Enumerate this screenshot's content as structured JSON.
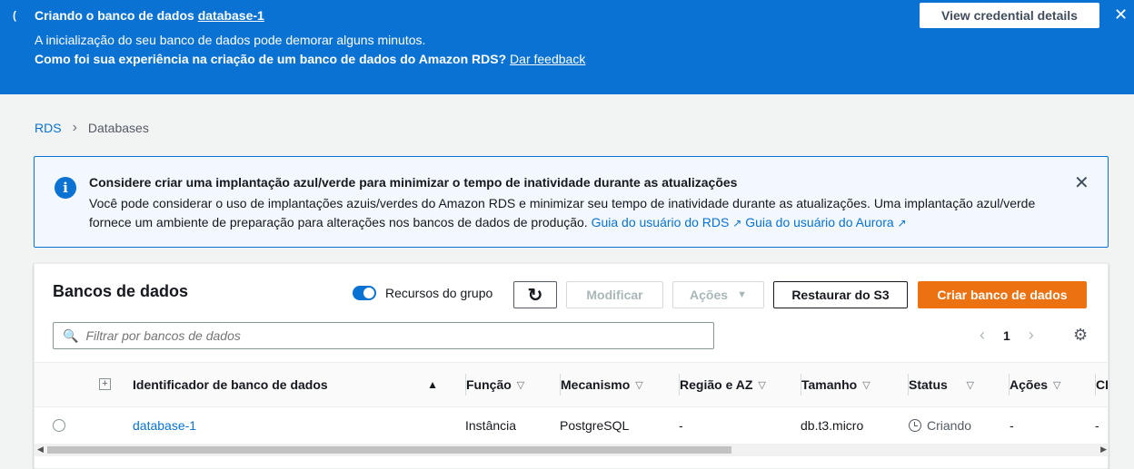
{
  "flash": {
    "title_prefix": "Criando o banco de dados",
    "title_link": "database-1",
    "message": "A inicialização do seu banco de dados pode demorar alguns minutos.",
    "feedback_question": "Como foi sua experiência na criação de um banco de dados do Amazon RDS?",
    "feedback_link": "Dar feedback",
    "credentials_button": "View credential details",
    "close_icon": "close-icon"
  },
  "breadcrumb": {
    "items": [
      "RDS",
      "Databases"
    ]
  },
  "alert": {
    "title": "Considere criar uma implantação azul/verde para minimizar o tempo de inatividade durante as atualizações",
    "body": "Você pode considerar o uso de implantações azuis/verdes do Amazon RDS e minimizar seu tempo de inatividade durante as atualizações. Uma implantação azul/verde fornece um ambiente de preparação para alterações nos bancos de dados de produção.",
    "link_rds": "Guia do usuário do RDS",
    "link_aurora": "Guia do usuário do Aurora"
  },
  "panel": {
    "title": "Bancos de dados",
    "group_toggle_label": "Recursos do grupo",
    "buttons": {
      "modify": "Modificar",
      "actions": "Ações",
      "restore": "Restaurar do S3",
      "create": "Criar banco de dados"
    },
    "search_placeholder": "Filtrar por bancos de dados",
    "page": "1"
  },
  "table": {
    "headers": {
      "identifier": "Identificador de banco de dados",
      "role": "Função",
      "engine": "Mecanismo",
      "region": "Região e AZ",
      "size": "Tamanho",
      "status": "Status",
      "actions": "Ações",
      "cpu": "CP"
    },
    "rows": [
      {
        "identifier": "database-1",
        "role": "Instância",
        "engine": "PostgreSQL",
        "region": "-",
        "size": "db.t3.micro",
        "status": "Criando",
        "actions": "-",
        "cpu": "-"
      }
    ]
  },
  "colors": {
    "primary_blue": "#0972d3",
    "orange": "#ec7211",
    "background": "#f2f3f3"
  }
}
